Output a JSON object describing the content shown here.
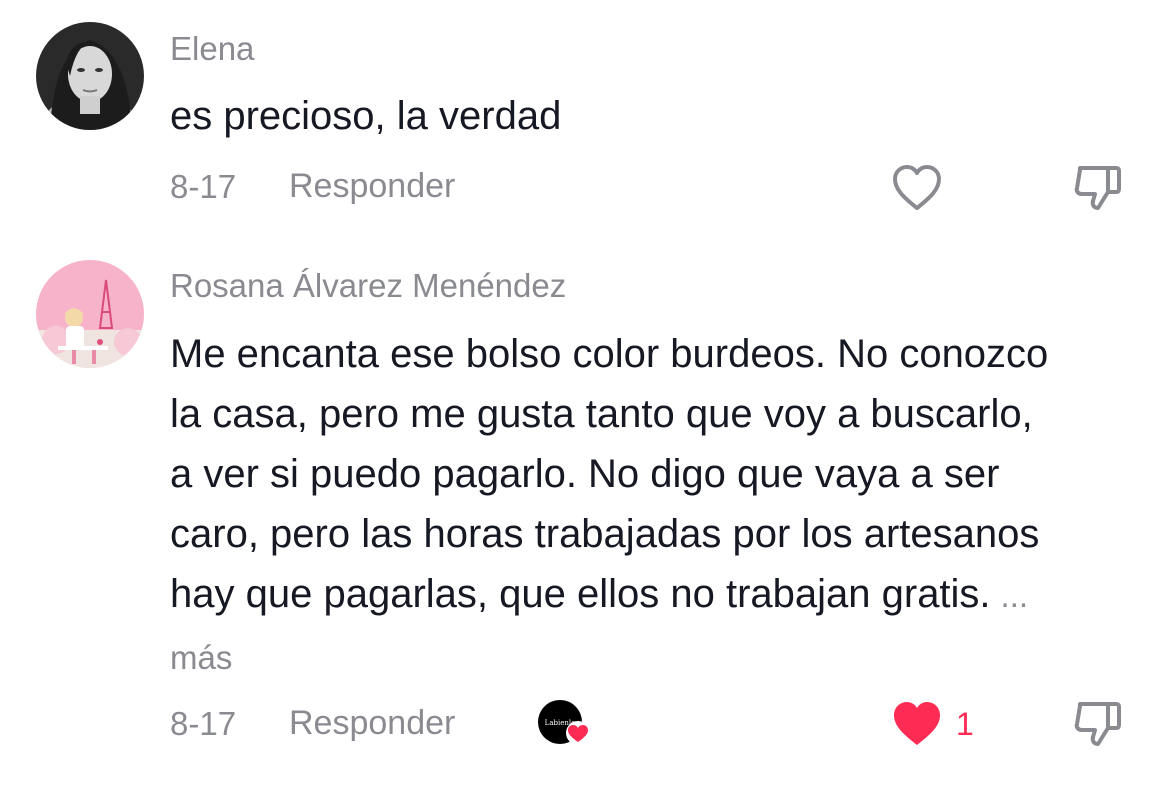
{
  "colors": {
    "text_primary": "#161823",
    "text_secondary": "#8a8b91",
    "like_active": "#fe2c55"
  },
  "comments": [
    {
      "username": "Elena",
      "text": "es precioso, la verdad",
      "date": "8-17",
      "reply_label": "Responder",
      "liked": false,
      "like_count": "",
      "icons": [
        "heart-outline-icon",
        "dislike-icon"
      ]
    },
    {
      "username": "Rosana Álvarez Menéndez",
      "text": "Me encanta ese bolso color burdeos. No conozco la casa, pero me gusta tanto que voy a buscarlo, a ver si puedo pagarlo. No digo que vaya a ser caro, pero las horas trabajadas por los artesanos hay que pagarlas, que ellos no trabajan gratis.",
      "more_label": "... más",
      "date": "8-17",
      "reply_label": "Responder",
      "creator_badge_text": "Labienlo",
      "liked": true,
      "like_count": "1",
      "icons": [
        "heart-filled-icon",
        "dislike-icon"
      ]
    }
  ]
}
